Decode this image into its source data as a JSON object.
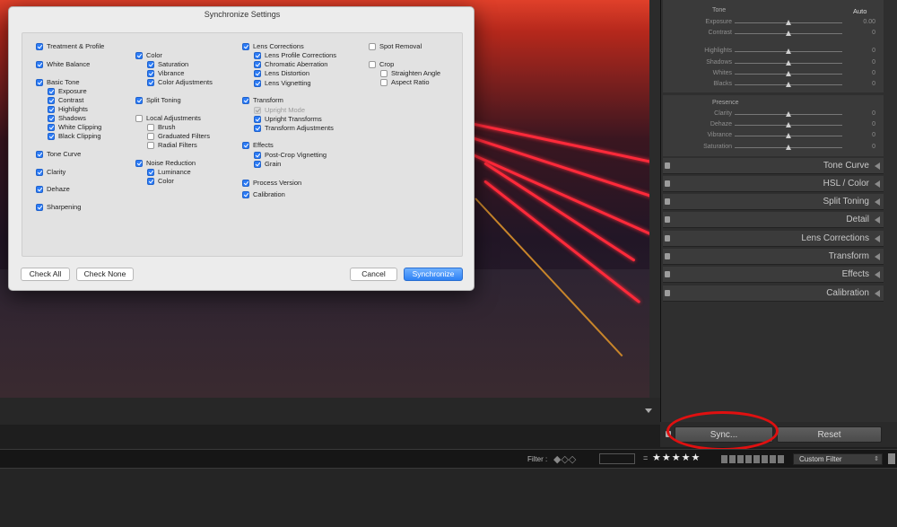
{
  "dialog": {
    "title": "Synchronize Settings",
    "buttons": {
      "check_all": "Check All",
      "check_none": "Check None",
      "cancel": "Cancel",
      "synchronize": "Synchronize"
    },
    "col1": [
      {
        "label": "Treatment & Profile",
        "checked": true
      },
      {
        "label": "White Balance",
        "checked": true
      },
      {
        "label": "Basic Tone",
        "checked": true
      },
      {
        "label": "Exposure",
        "checked": true
      },
      {
        "label": "Contrast",
        "checked": true
      },
      {
        "label": "Highlights",
        "checked": true
      },
      {
        "label": "Shadows",
        "checked": true
      },
      {
        "label": "White Clipping",
        "checked": true
      },
      {
        "label": "Black Clipping",
        "checked": true
      },
      {
        "label": "Tone Curve",
        "checked": true
      },
      {
        "label": "Clarity",
        "checked": true
      },
      {
        "label": "Dehaze",
        "checked": true
      },
      {
        "label": "Sharpening",
        "checked": true
      }
    ],
    "col2": [
      {
        "label": "Color",
        "checked": true
      },
      {
        "label": "Saturation",
        "checked": true
      },
      {
        "label": "Vibrance",
        "checked": true
      },
      {
        "label": "Color Adjustments",
        "checked": true
      },
      {
        "label": "Split Toning",
        "checked": true
      },
      {
        "label": "Local Adjustments",
        "checked": false
      },
      {
        "label": "Brush",
        "checked": false
      },
      {
        "label": "Graduated Filters",
        "checked": false
      },
      {
        "label": "Radial Filters",
        "checked": false
      },
      {
        "label": "Noise Reduction",
        "checked": true
      },
      {
        "label": "Luminance",
        "checked": true
      },
      {
        "label": "Color",
        "checked": true
      }
    ],
    "col3": [
      {
        "label": "Lens Corrections",
        "checked": true
      },
      {
        "label": "Lens Profile Corrections",
        "checked": true
      },
      {
        "label": "Chromatic Aberration",
        "checked": true
      },
      {
        "label": "Lens Distortion",
        "checked": true
      },
      {
        "label": "Lens Vignetting",
        "checked": true
      },
      {
        "label": "Transform",
        "checked": true
      },
      {
        "label": "Upright Mode",
        "checked": true,
        "disabled": true
      },
      {
        "label": "Upright Transforms",
        "checked": true
      },
      {
        "label": "Transform Adjustments",
        "checked": true
      },
      {
        "label": "Effects",
        "checked": true
      },
      {
        "label": "Post-Crop Vignetting",
        "checked": true
      },
      {
        "label": "Grain",
        "checked": true
      },
      {
        "label": "Process Version",
        "checked": true
      },
      {
        "label": "Calibration",
        "checked": true
      }
    ],
    "col4": [
      {
        "label": "Spot Removal",
        "checked": false
      },
      {
        "label": "Crop",
        "checked": false
      },
      {
        "label": "Straighten Angle",
        "checked": false
      },
      {
        "label": "Aspect Ratio",
        "checked": false
      }
    ]
  },
  "develop": {
    "tone_title": "Tone",
    "auto_label": "Auto",
    "tone_sliders": [
      {
        "label": "Exposure",
        "value": "0.00"
      },
      {
        "label": "Contrast",
        "value": "0"
      },
      {
        "label": "Highlights",
        "value": "0"
      },
      {
        "label": "Shadows",
        "value": "0"
      },
      {
        "label": "Whites",
        "value": "0"
      },
      {
        "label": "Blacks",
        "value": "0"
      }
    ],
    "presence_title": "Presence",
    "presence_sliders": [
      {
        "label": "Clarity",
        "value": "0"
      },
      {
        "label": "Dehaze",
        "value": "0"
      },
      {
        "label": "Vibrance",
        "value": "0"
      },
      {
        "label": "Saturation",
        "value": "0"
      }
    ],
    "panels": [
      "Tone Curve",
      "HSL / Color",
      "Split Toning",
      "Detail",
      "Lens Corrections",
      "Transform",
      "Effects",
      "Calibration"
    ],
    "sync_label": "Sync...",
    "reset_label": "Reset"
  },
  "filter_bar": {
    "filter_label": "Filter :",
    "equals": "=",
    "stars": "★★★★★",
    "custom_filter": "Custom Filter"
  },
  "colors": {
    "accent": "#2d7cf6",
    "highlight_circle": "#e01010",
    "streak": "#ff2a3a"
  }
}
